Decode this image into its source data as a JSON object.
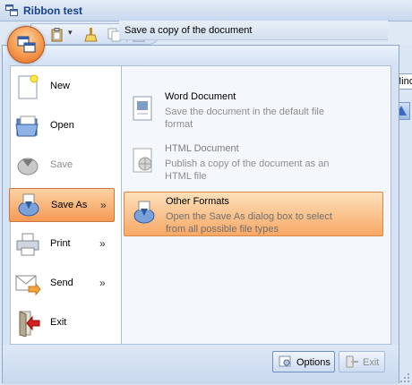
{
  "window": {
    "title": "Ribbon test"
  },
  "ribbon": {
    "minor_tab_label": "Mino"
  },
  "menu": {
    "items": [
      {
        "label": "New",
        "enabled": true,
        "submenu": false
      },
      {
        "label": "Open",
        "enabled": true,
        "submenu": false
      },
      {
        "label": "Save",
        "enabled": false,
        "submenu": false
      },
      {
        "label": "Save As",
        "enabled": true,
        "submenu": true,
        "active": true
      },
      {
        "label": "Print",
        "enabled": true,
        "submenu": true
      },
      {
        "label": "Send",
        "enabled": true,
        "submenu": true
      },
      {
        "label": "Exit",
        "enabled": true,
        "submenu": false
      }
    ],
    "submenu_arrow": "»",
    "panel": {
      "header": "Save a copy of the document",
      "items": [
        {
          "title": "Word Document",
          "description": "Save the document in the default file format",
          "enabled": true
        },
        {
          "title": "HTML Document",
          "description": "Publish a copy of the document as an HTML file",
          "enabled": false
        },
        {
          "title": "Other Formats",
          "description": "Open the Save As dialog box to select from all possible file types",
          "enabled": true,
          "active": true
        }
      ]
    },
    "footer": {
      "options_label": "Options",
      "exit_label": "Exit"
    }
  },
  "colors": {
    "accent": "#f59a55",
    "frame": "#8da6c9",
    "text": "#15428b"
  }
}
